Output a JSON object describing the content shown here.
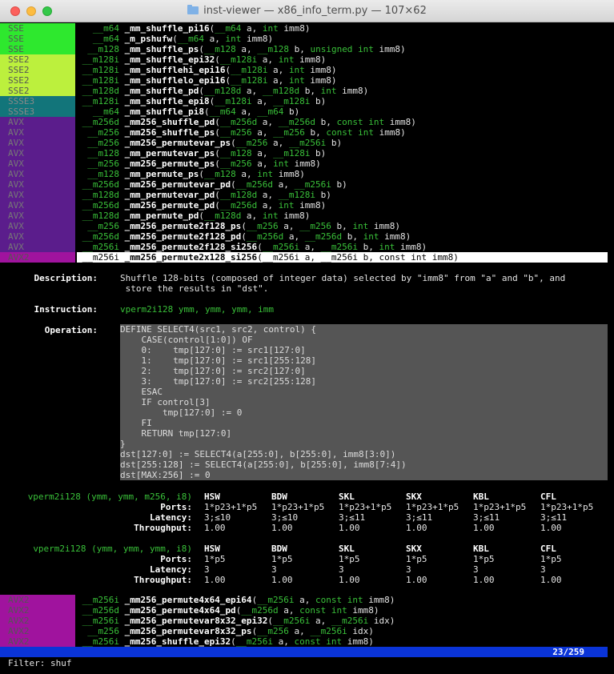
{
  "window": {
    "title": "inst-viewer — x86_info_term.py — 107×62"
  },
  "top_list": [
    {
      "tag": "SSE",
      "cls": "t-sse",
      "ret": "   __m64",
      "name": "_mm_shuffle_pi16",
      "args": "(__m64 a, int imm8)"
    },
    {
      "tag": "SSE",
      "cls": "t-sse",
      "ret": "   __m64",
      "name": "_m_pshufw",
      "args": "(__m64 a, int imm8)"
    },
    {
      "tag": "SSE",
      "cls": "t-sse",
      "ret": "  __m128",
      "name": "_mm_shuffle_ps",
      "args": "(__m128 a, __m128 b, unsigned int imm8)"
    },
    {
      "tag": "SSE2",
      "cls": "t-sse2",
      "ret": " __m128i",
      "name": "_mm_shuffle_epi32",
      "args": "(__m128i a, int imm8)"
    },
    {
      "tag": "SSE2",
      "cls": "t-sse2",
      "ret": " __m128i",
      "name": "_mm_shufflehi_epi16",
      "args": "(__m128i a, int imm8)"
    },
    {
      "tag": "SSE2",
      "cls": "t-sse2",
      "ret": " __m128i",
      "name": "_mm_shufflelo_epi16",
      "args": "(__m128i a, int imm8)"
    },
    {
      "tag": "SSE2",
      "cls": "t-sse2",
      "ret": " __m128d",
      "name": "_mm_shuffle_pd",
      "args": "(__m128d a, __m128d b, int imm8)"
    },
    {
      "tag": "SSSE3",
      "cls": "t-ssse3",
      "ret": " __m128i",
      "name": "_mm_shuffle_epi8",
      "args": "(__m128i a, __m128i b)"
    },
    {
      "tag": "SSSE3",
      "cls": "t-ssse3",
      "ret": "   __m64",
      "name": "_mm_shuffle_pi8",
      "args": "(__m64 a, __m64 b)"
    },
    {
      "tag": "AVX",
      "cls": "t-avx",
      "ret": " __m256d",
      "name": "_mm256_shuffle_pd",
      "args": "(__m256d a, __m256d b, const int imm8)"
    },
    {
      "tag": "AVX",
      "cls": "t-avx",
      "ret": "  __m256",
      "name": "_mm256_shuffle_ps",
      "args": "(__m256 a, __m256 b, const int imm8)"
    },
    {
      "tag": "AVX",
      "cls": "t-avx",
      "ret": "  __m256",
      "name": "_mm256_permutevar_ps",
      "args": "(__m256 a, __m256i b)"
    },
    {
      "tag": "AVX",
      "cls": "t-avx",
      "ret": "  __m128",
      "name": "_mm_permutevar_ps",
      "args": "(__m128 a, __m128i b)"
    },
    {
      "tag": "AVX",
      "cls": "t-avx",
      "ret": "  __m256",
      "name": "_mm256_permute_ps",
      "args": "(__m256 a, int imm8)"
    },
    {
      "tag": "AVX",
      "cls": "t-avx",
      "ret": "  __m128",
      "name": "_mm_permute_ps",
      "args": "(__m128 a, int imm8)"
    },
    {
      "tag": "AVX",
      "cls": "t-avx",
      "ret": " __m256d",
      "name": "_mm256_permutevar_pd",
      "args": "(__m256d a, __m256i b)"
    },
    {
      "tag": "AVX",
      "cls": "t-avx",
      "ret": " __m128d",
      "name": "_mm_permutevar_pd",
      "args": "(__m128d a, __m128i b)"
    },
    {
      "tag": "AVX",
      "cls": "t-avx",
      "ret": " __m256d",
      "name": "_mm256_permute_pd",
      "args": "(__m256d a, int imm8)"
    },
    {
      "tag": "AVX",
      "cls": "t-avx",
      "ret": " __m128d",
      "name": "_mm_permute_pd",
      "args": "(__m128d a, int imm8)"
    },
    {
      "tag": "AVX",
      "cls": "t-avx",
      "ret": "  __m256",
      "name": "_mm256_permute2f128_ps",
      "args": "(__m256 a, __m256 b, int imm8)"
    },
    {
      "tag": "AVX",
      "cls": "t-avx",
      "ret": " __m256d",
      "name": "_mm256_permute2f128_pd",
      "args": "(__m256d a, __m256d b, int imm8)"
    },
    {
      "tag": "AVX",
      "cls": "t-avx",
      "ret": " __m256i",
      "name": "_mm256_permute2f128_si256",
      "args": "(__m256i a, __m256i b, int imm8)"
    },
    {
      "tag": "AVX2",
      "cls": "t-avx2",
      "ret": " __m256i",
      "name": "_mm256_permute2x128_si256",
      "args": "(__m256i a, __m256i b, const int imm8)",
      "selected": true
    }
  ],
  "detail": {
    "description_label": "Description:",
    "description": "Shuffle 128-bits (composed of integer data) selected by \"imm8\" from \"a\" and \"b\", and\n store the results in \"dst\".",
    "instruction_label": "Instruction:",
    "instruction": "vperm2i128 ymm, ymm, ymm, imm",
    "operation_label": "Operation:",
    "operation": "DEFINE SELECT4(src1, src2, control) {\n    CASE(control[1:0]) OF\n    0:    tmp[127:0] := src1[127:0]\n    1:    tmp[127:0] := src1[255:128]\n    2:    tmp[127:0] := src2[127:0]\n    3:    tmp[127:0] := src2[255:128]\n    ESAC\n    IF control[3]\n        tmp[127:0] := 0\n    FI\n    RETURN tmp[127:0]\n}\ndst[127:0] := SELECT4(a[255:0], b[255:0], imm8[3:0])\ndst[255:128] := SELECT4(a[255:0], b[255:0], imm8[7:4])\ndst[MAX:256] := 0"
  },
  "latency_tables": [
    {
      "form": "vperm2i128 (ymm, ymm, m256, i8)",
      "archs": [
        "HSW",
        "BDW",
        "SKL",
        "SKX",
        "KBL",
        "CFL"
      ],
      "rows": [
        {
          "label": "Ports:",
          "values": [
            "1*p23+1*p5",
            "1*p23+1*p5",
            "1*p23+1*p5",
            "1*p23+1*p5",
            "1*p23+1*p5",
            "1*p23+1*p5"
          ]
        },
        {
          "label": "Latency:",
          "values": [
            "3;≤10",
            "3;≤10",
            "3;≤11",
            "3;≤11",
            "3;≤11",
            "3;≤11"
          ]
        },
        {
          "label": "Throughput:",
          "values": [
            "1.00",
            "1.00",
            "1.00",
            "1.00",
            "1.00",
            "1.00"
          ]
        }
      ]
    },
    {
      "form": "vperm2i128 (ymm, ymm, ymm, i8)",
      "archs": [
        "HSW",
        "BDW",
        "SKL",
        "SKX",
        "KBL",
        "CFL"
      ],
      "rows": [
        {
          "label": "Ports:",
          "values": [
            "1*p5",
            "1*p5",
            "1*p5",
            "1*p5",
            "1*p5",
            "1*p5"
          ]
        },
        {
          "label": "Latency:",
          "values": [
            "3",
            "3",
            "3",
            "3",
            "3",
            "3"
          ]
        },
        {
          "label": "Throughput:",
          "values": [
            "1.00",
            "1.00",
            "1.00",
            "1.00",
            "1.00",
            "1.00"
          ]
        }
      ]
    }
  ],
  "bottom_list": [
    {
      "tag": "AVX2",
      "cls": "t-avx2",
      "ret": " __m256i",
      "name": "_mm256_permute4x64_epi64",
      "args": "(__m256i a, const int imm8)"
    },
    {
      "tag": "AVX2",
      "cls": "t-avx2",
      "ret": " __m256d",
      "name": "_mm256_permute4x64_pd",
      "args": "(__m256d a, const int imm8)"
    },
    {
      "tag": "AVX2",
      "cls": "t-avx2",
      "ret": " __m256i",
      "name": "_mm256_permutevar8x32_epi32",
      "args": "(__m256i a, __m256i idx)"
    },
    {
      "tag": "AVX2",
      "cls": "t-avx2",
      "ret": "  __m256",
      "name": "_mm256_permutevar8x32_ps",
      "args": "(__m256 a, __m256i idx)"
    },
    {
      "tag": "AVX2",
      "cls": "t-avx2",
      "ret": " __m256i",
      "name": "_mm256_shuffle_epi32",
      "args": "(__m256i a, const int imm8)"
    }
  ],
  "status": {
    "position": "23/259"
  },
  "filter": {
    "label": "Filter:",
    "value": "shuf"
  }
}
